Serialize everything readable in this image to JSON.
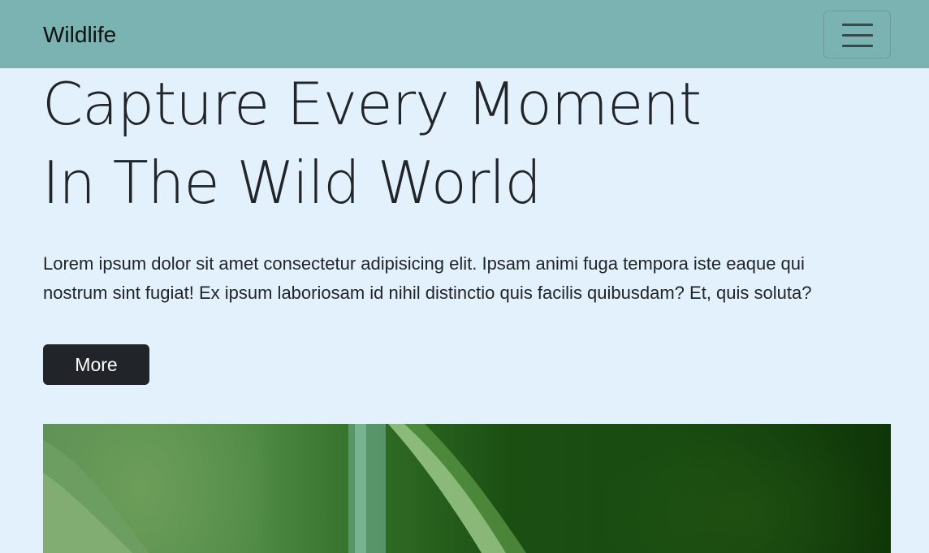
{
  "navbar": {
    "brand": "Wildlife",
    "toggler_icon": "hamburger-menu-icon",
    "background_color": "#7bb2b2"
  },
  "hero": {
    "title_line1": "Capture Every Moment",
    "title_line2": "In The Wild World",
    "lead_line1": "Lorem ipsum dolor sit amet consectetur adipisicing elit. Ipsam animi fuga tempora iste eaque qui",
    "lead_line2": "nostrum sint fugiat! Ex ipsum laboriosam id nihil distinctio quis facilis quibusdam? Et, quis soluta?",
    "button_label": "More",
    "button_color": "#212529"
  },
  "page": {
    "background_color": "#e3f1fc"
  }
}
